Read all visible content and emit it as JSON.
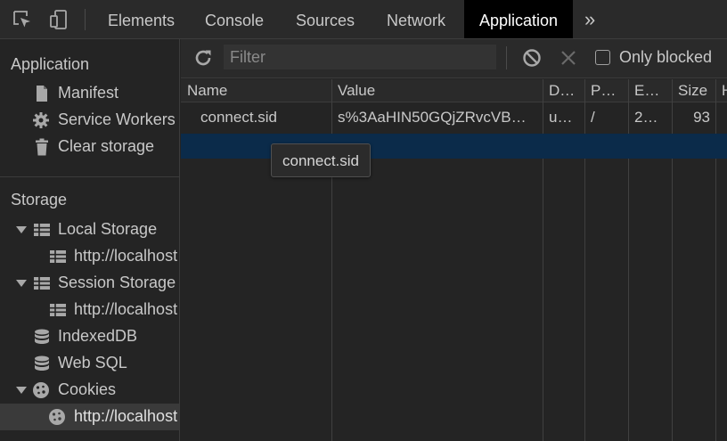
{
  "tabs": [
    {
      "label": "Elements"
    },
    {
      "label": "Console"
    },
    {
      "label": "Sources"
    },
    {
      "label": "Network"
    },
    {
      "label": "Application",
      "active": true
    }
  ],
  "tabs_more": "»",
  "sidebar": {
    "application_title": "Application",
    "application_items": [
      "Manifest",
      "Service Workers",
      "Clear storage"
    ],
    "storage_title": "Storage",
    "storage_items": {
      "local_storage": "Local Storage",
      "local_storage_child": "http://localhost",
      "session_storage": "Session Storage",
      "session_storage_child": "http://localhost",
      "indexeddb": "IndexedDB",
      "websql": "Web SQL",
      "cookies": "Cookies",
      "cookies_child": "http://localhost"
    }
  },
  "toolbar": {
    "filter_placeholder": "Filter",
    "only_blocked_label": "Only blocked",
    "only_blocked_checked": false
  },
  "table": {
    "columns": [
      "Name",
      "Value",
      "D…",
      "P…",
      "E…",
      "Size",
      "H"
    ],
    "rows": [
      {
        "name": "connect.sid",
        "value": "s%3AaHIN50GQjZRvcVB…",
        "domain": "u…",
        "path": "/",
        "expires": "2…",
        "size": "93"
      }
    ]
  },
  "tooltip": "connect.sid",
  "colors": {
    "active_tab": "#000000",
    "selected_row": "#0b2b4a",
    "background": "#242424"
  }
}
